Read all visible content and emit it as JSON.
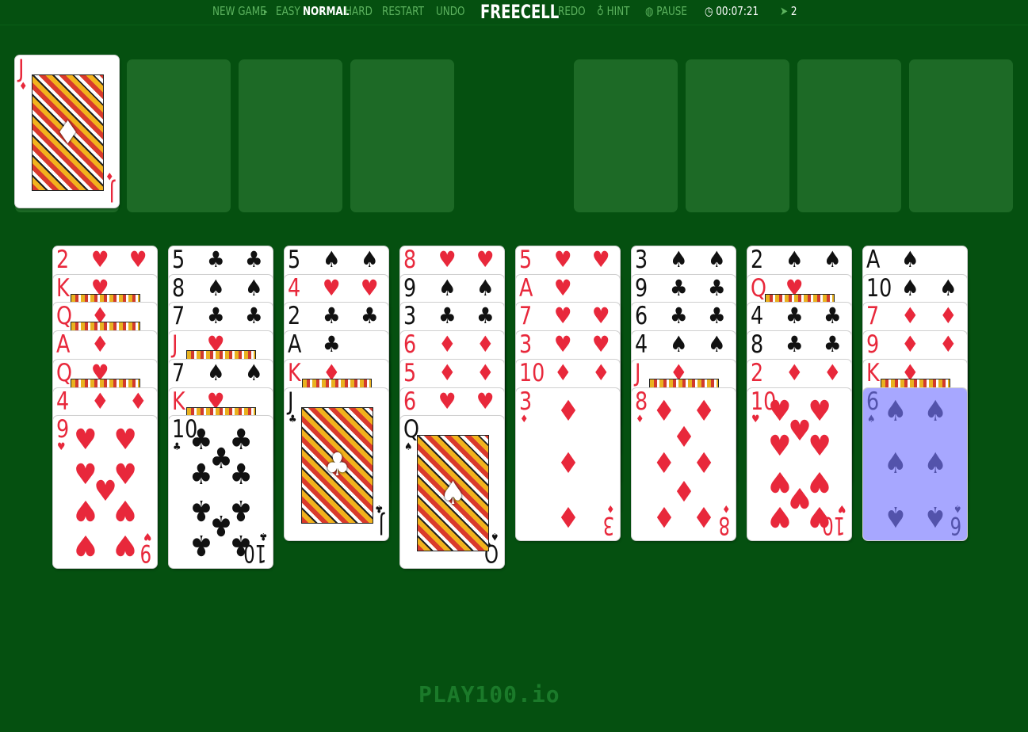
{
  "toolbar": {
    "new_game": "NEW GAME",
    "easy": "EASY",
    "normal": "NORMAL",
    "hard": "HARD",
    "restart": "RESTART",
    "undo": "UNDO",
    "title": "FREECELL",
    "redo": "REDO",
    "hint": "HINT",
    "pause": "PAUSE",
    "timer": "00:07:21",
    "moves": "2",
    "selected_difficulty": "NORMAL"
  },
  "icons": {
    "menu_arrow": "caret-right-icon",
    "hint": "lightbulb-icon",
    "pause": "pause-circle-icon",
    "timer": "clock-icon",
    "moves": "cursor-icon"
  },
  "colors": {
    "felt": "#055010",
    "slot": "#1d6a26",
    "nav_text": "#5db35f",
    "red_suit": "#e8283b",
    "black_suit": "#111111",
    "selection": "#8080ff"
  },
  "free_cells": [
    {
      "rank": "J",
      "suit": "♦",
      "color": "red"
    },
    null,
    null,
    null
  ],
  "foundations": [
    null,
    null,
    null,
    null
  ],
  "tableau": [
    [
      {
        "rank": "2",
        "suit": "♥",
        "color": "red"
      },
      {
        "rank": "K",
        "suit": "♥",
        "color": "red"
      },
      {
        "rank": "Q",
        "suit": "♦",
        "color": "red"
      },
      {
        "rank": "A",
        "suit": "♦",
        "color": "red"
      },
      {
        "rank": "Q",
        "suit": "♥",
        "color": "red"
      },
      {
        "rank": "4",
        "suit": "♦",
        "color": "red"
      },
      {
        "rank": "9",
        "suit": "♥",
        "color": "red"
      }
    ],
    [
      {
        "rank": "5",
        "suit": "♣",
        "color": "black"
      },
      {
        "rank": "8",
        "suit": "♠",
        "color": "black"
      },
      {
        "rank": "7",
        "suit": "♣",
        "color": "black"
      },
      {
        "rank": "J",
        "suit": "♥",
        "color": "red"
      },
      {
        "rank": "7",
        "suit": "♠",
        "color": "black"
      },
      {
        "rank": "K",
        "suit": "♥",
        "color": "red"
      },
      {
        "rank": "10",
        "suit": "♣",
        "color": "black"
      }
    ],
    [
      {
        "rank": "5",
        "suit": "♠",
        "color": "black"
      },
      {
        "rank": "4",
        "suit": "♥",
        "color": "red"
      },
      {
        "rank": "2",
        "suit": "♣",
        "color": "black"
      },
      {
        "rank": "A",
        "suit": "♣",
        "color": "black"
      },
      {
        "rank": "K",
        "suit": "♦",
        "color": "red"
      },
      {
        "rank": "J",
        "suit": "♣",
        "color": "black"
      }
    ],
    [
      {
        "rank": "8",
        "suit": "♥",
        "color": "red"
      },
      {
        "rank": "9",
        "suit": "♠",
        "color": "black"
      },
      {
        "rank": "3",
        "suit": "♣",
        "color": "black"
      },
      {
        "rank": "6",
        "suit": "♦",
        "color": "red"
      },
      {
        "rank": "5",
        "suit": "♦",
        "color": "red"
      },
      {
        "rank": "6",
        "suit": "♥",
        "color": "red"
      },
      {
        "rank": "Q",
        "suit": "♠",
        "color": "black"
      }
    ],
    [
      {
        "rank": "5",
        "suit": "♥",
        "color": "red"
      },
      {
        "rank": "A",
        "suit": "♥",
        "color": "red"
      },
      {
        "rank": "7",
        "suit": "♥",
        "color": "red"
      },
      {
        "rank": "3",
        "suit": "♥",
        "color": "red"
      },
      {
        "rank": "10",
        "suit": "♦",
        "color": "red"
      },
      {
        "rank": "3",
        "suit": "♦",
        "color": "red"
      }
    ],
    [
      {
        "rank": "3",
        "suit": "♠",
        "color": "black"
      },
      {
        "rank": "9",
        "suit": "♣",
        "color": "black"
      },
      {
        "rank": "6",
        "suit": "♣",
        "color": "black"
      },
      {
        "rank": "4",
        "suit": "♠",
        "color": "black"
      },
      {
        "rank": "J",
        "suit": "♦",
        "color": "red"
      },
      {
        "rank": "8",
        "suit": "♦",
        "color": "red"
      }
    ],
    [
      {
        "rank": "2",
        "suit": "♠",
        "color": "black"
      },
      {
        "rank": "Q",
        "suit": "♥",
        "color": "red"
      },
      {
        "rank": "4",
        "suit": "♣",
        "color": "black"
      },
      {
        "rank": "8",
        "suit": "♣",
        "color": "black"
      },
      {
        "rank": "2",
        "suit": "♦",
        "color": "red"
      },
      {
        "rank": "10",
        "suit": "♥",
        "color": "red"
      }
    ],
    [
      {
        "rank": "A",
        "suit": "♠",
        "color": "black"
      },
      {
        "rank": "10",
        "suit": "♠",
        "color": "black"
      },
      {
        "rank": "7",
        "suit": "♦",
        "color": "red"
      },
      {
        "rank": "9",
        "suit": "♦",
        "color": "red"
      },
      {
        "rank": "K",
        "suit": "♦",
        "color": "red"
      },
      {
        "rank": "6",
        "suit": "♠",
        "color": "black",
        "selected": true
      }
    ]
  ],
  "footer": {
    "logo": "PLAY100.io"
  }
}
